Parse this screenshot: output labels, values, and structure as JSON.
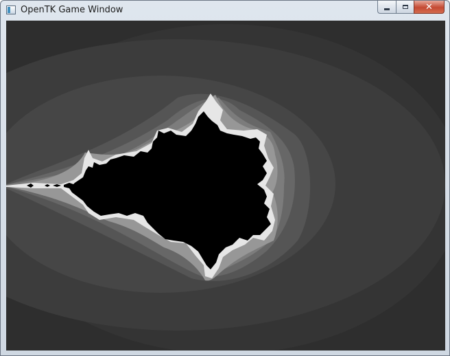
{
  "window": {
    "title": "OpenTK Game Window",
    "controls": {
      "minimize_icon": "minimize-icon",
      "maximize_icon": "maximize-icon",
      "close_icon": "close-icon",
      "close_glyph": "✕"
    }
  },
  "viewport": {
    "content": "mandelbrot-fractal",
    "colors": {
      "background": "#2e2e2e",
      "band_1": "#343434",
      "band_2": "#3c3c3c",
      "band_3": "#464646",
      "band_4": "#555555",
      "band_5": "#676767",
      "band_6": "#7c7c7c",
      "band_7": "#979797",
      "edge": "#e6e6e6",
      "set": "#000000"
    }
  }
}
